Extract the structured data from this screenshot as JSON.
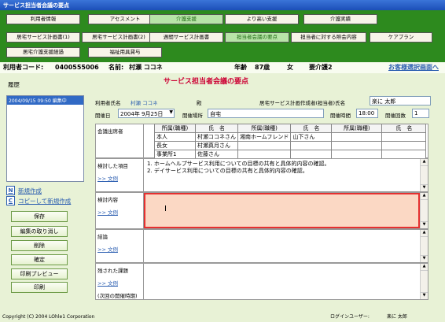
{
  "window": {
    "title": "サービス担当者会議の要点"
  },
  "nav": {
    "row1": [
      "利用者情報",
      "アセスメント",
      "介護支援",
      "より高い支援",
      "介護実績"
    ],
    "row2": [
      "居宅サービス計画書(1)",
      "居宅サービス計画書(2)",
      "週間サービス計画書",
      "担当者会議の要点",
      "担当者に対する照会内容",
      "ケアプラン"
    ],
    "row3": [
      "居宅介護支援経過",
      "福祉用具貸与"
    ]
  },
  "info": {
    "user_code_label": "利用者コード:",
    "user_code": "0400555006",
    "name_label": "名前:",
    "name": "村瀬 ココネ",
    "age_label": "年齢",
    "age": "87歳",
    "gender": "女",
    "care_level": "要介護2",
    "customer_select": "お客様選択画面へ"
  },
  "left": {
    "history_title": "履歴",
    "history_item": "2004/09/15 09:50 編集中",
    "new_create": "新規作成",
    "copy_create": "コピーして新規作成",
    "buttons": [
      "保存",
      "編集の取り消し",
      "削除",
      "確定",
      "印刷プレビュー",
      "印刷"
    ]
  },
  "form": {
    "page_title": "サービス担当者会議の要点",
    "user_name_label": "利用者氏名",
    "user_name": "村瀬 ココネ",
    "honorific": "殿",
    "planner_label": "居宅サービス計画作成者(担当者)氏名",
    "planner": "楽に 太郎",
    "date_label": "開催日",
    "date": "2004年 9月25日",
    "place_label": "開催場所",
    "place": "自宅",
    "time_label": "開催時間",
    "time": "18:00",
    "count_label": "開催回数",
    "count": "1",
    "attendees_label": "会議出席者",
    "col_affil": "所属(職種)",
    "col_name": "氏　名",
    "attendees": [
      [
        "本人",
        "村瀬ココネさん",
        "湘南ホームフレンド",
        "山下さん",
        "",
        ""
      ],
      [
        "長女",
        "村瀬真月さん",
        "",
        "",
        "",
        ""
      ],
      [
        "事業所1",
        "佐藤さん",
        "",
        "",
        "",
        ""
      ]
    ],
    "sections": [
      {
        "label": "検討した項目",
        "link": ">> 文例",
        "text1": "1. ホームヘルプサービス利用についての目標の共有と具体的内容の確認。",
        "text2": "2. デイサービス利用についての目標の共有と具体的内容の確認。"
      },
      {
        "label": "検討内容",
        "link": ">> 文例",
        "text1": "",
        "text2": ""
      },
      {
        "label": "結論",
        "link": ">> 文例",
        "text1": "",
        "text2": ""
      },
      {
        "label": "残された課題",
        "link": ">> 文例",
        "text1": "(次回の開催時期)",
        "text2": ""
      }
    ]
  },
  "footer": {
    "copyright": "Copyright (C) 2004 LOhle1 Corporation",
    "login_label": "ログインユーザー:",
    "login_user": "楽に 太郎"
  }
}
